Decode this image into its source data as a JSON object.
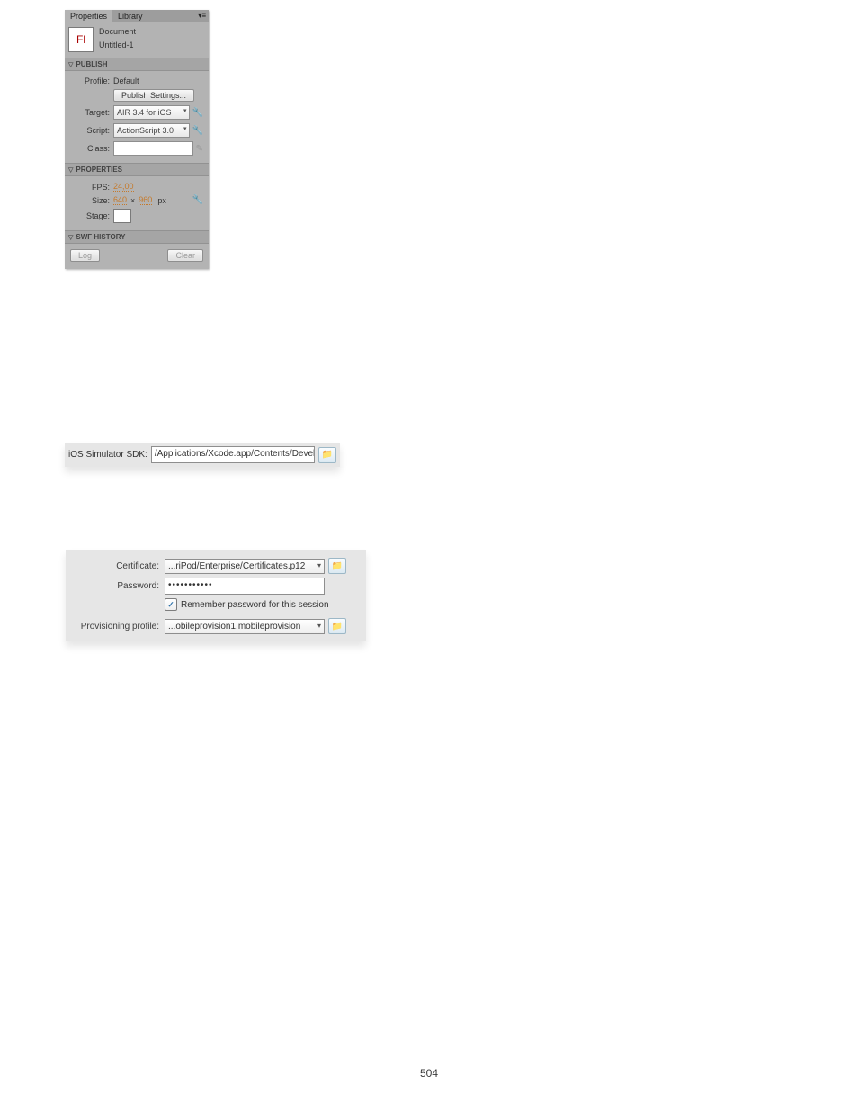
{
  "panel1": {
    "tabs": {
      "properties": "Properties",
      "library": "Library"
    },
    "doc_type": "Document",
    "doc_name": "Untitled-1",
    "sect_publish": "PUBLISH",
    "profile_lbl": "Profile:",
    "profile_val": "Default",
    "publish_settings_btn": "Publish Settings...",
    "target_lbl": "Target:",
    "target_val": "AIR 3.4 for iOS",
    "script_lbl": "Script:",
    "script_val": "ActionScript 3.0",
    "class_lbl": "Class:",
    "sect_properties": "PROPERTIES",
    "fps_lbl": "FPS:",
    "fps_val": "24,00",
    "size_lbl": "Size:",
    "size_w": "640",
    "size_x": "×",
    "size_h": "960",
    "size_unit": "px",
    "stage_lbl": "Stage:",
    "sect_swf": "SWF HISTORY",
    "log_btn": "Log",
    "clear_btn": "Clear"
  },
  "panel2": {
    "label": "iOS Simulator SDK:",
    "value": "/Applications/Xcode.app/Contents/Developer/Platfor"
  },
  "panel3": {
    "cert_lbl": "Certificate:",
    "cert_val": "...riPod/Enterprise/Certificates.p12",
    "pw_lbl": "Password:",
    "pw_val": "•••••••••••",
    "remember_lbl": "Remember password for this session",
    "prov_lbl": "Provisioning profile:",
    "prov_val": "...obileprovision1.mobileprovision"
  },
  "page_number": "504"
}
